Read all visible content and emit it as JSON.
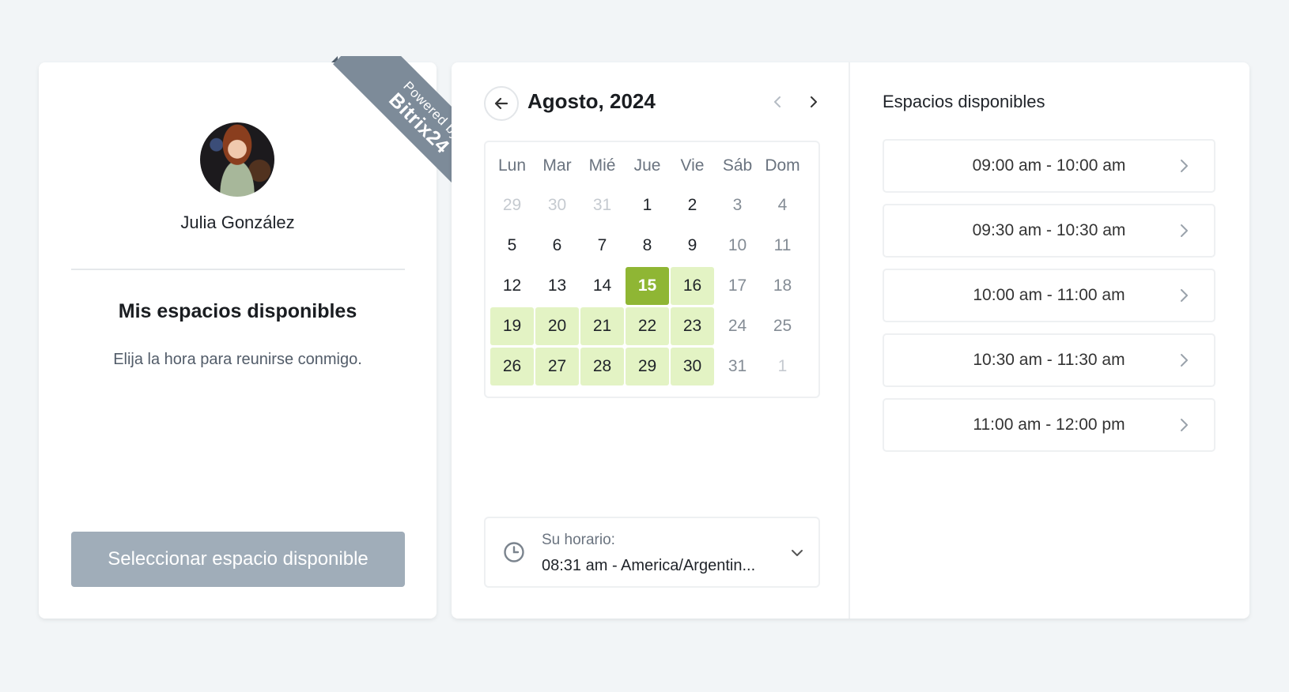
{
  "profile": {
    "name": "Julia González",
    "badge_line1": "Powered by",
    "badge_line2": "Bitrix24",
    "section_title": "Mis espacios disponibles",
    "section_desc": "Elija la hora para reunirse conmigo.",
    "select_button": "Seleccionar espacio disponible"
  },
  "calendar": {
    "month_title": "Agosto, 2024",
    "weekdays": [
      "Lun",
      "Mar",
      "Mié",
      "Jue",
      "Vie",
      "Sáb",
      "Dom"
    ],
    "weeks": [
      [
        {
          "d": "29",
          "t": "other"
        },
        {
          "d": "30",
          "t": "other"
        },
        {
          "d": "31",
          "t": "other"
        },
        {
          "d": "1",
          "t": "day"
        },
        {
          "d": "2",
          "t": "day"
        },
        {
          "d": "3",
          "t": "weekend"
        },
        {
          "d": "4",
          "t": "weekend"
        }
      ],
      [
        {
          "d": "5",
          "t": "day"
        },
        {
          "d": "6",
          "t": "day"
        },
        {
          "d": "7",
          "t": "day"
        },
        {
          "d": "8",
          "t": "day"
        },
        {
          "d": "9",
          "t": "day"
        },
        {
          "d": "10",
          "t": "weekend"
        },
        {
          "d": "11",
          "t": "weekend"
        }
      ],
      [
        {
          "d": "12",
          "t": "day"
        },
        {
          "d": "13",
          "t": "day"
        },
        {
          "d": "14",
          "t": "day"
        },
        {
          "d": "15",
          "t": "selected"
        },
        {
          "d": "16",
          "t": "avail"
        },
        {
          "d": "17",
          "t": "weekend"
        },
        {
          "d": "18",
          "t": "weekend"
        }
      ],
      [
        {
          "d": "19",
          "t": "avail"
        },
        {
          "d": "20",
          "t": "avail"
        },
        {
          "d": "21",
          "t": "avail"
        },
        {
          "d": "22",
          "t": "avail"
        },
        {
          "d": "23",
          "t": "avail"
        },
        {
          "d": "24",
          "t": "weekend"
        },
        {
          "d": "25",
          "t": "weekend"
        }
      ],
      [
        {
          "d": "26",
          "t": "avail"
        },
        {
          "d": "27",
          "t": "avail"
        },
        {
          "d": "28",
          "t": "avail"
        },
        {
          "d": "29",
          "t": "avail"
        },
        {
          "d": "30",
          "t": "avail"
        },
        {
          "d": "31",
          "t": "weekend"
        },
        {
          "d": "1",
          "t": "other"
        }
      ]
    ]
  },
  "timezone": {
    "label": "Su horario:",
    "value": "08:31 am - America/Argentin..."
  },
  "slots": {
    "title": "Espacios disponibles",
    "items": [
      "09:00 am - 10:00 am",
      "09:30 am - 10:30 am",
      "10:00 am - 11:00 am",
      "10:30 am - 11:30 am",
      "11:00 am - 12:00 pm"
    ]
  },
  "colors": {
    "selected_day": "#8fb634",
    "available_day": "#e3f3c4",
    "button_disabled": "#a0adb9",
    "ribbon": "#7d8b99"
  },
  "icons": [
    "arrow-left-icon",
    "chevron-left-icon",
    "chevron-right-icon",
    "clock-icon",
    "chevron-down-icon"
  ]
}
